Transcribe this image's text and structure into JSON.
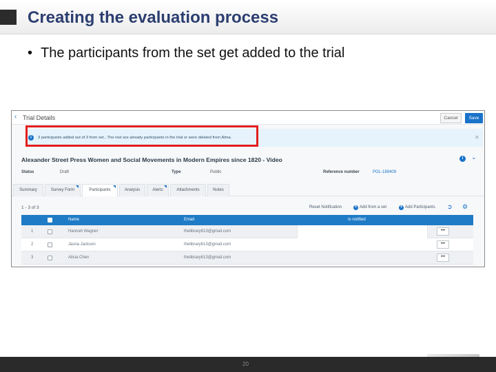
{
  "slide": {
    "title": "Creating the evaluation process",
    "bullet": "The participants from the set get added to the trial",
    "page_number": "20"
  },
  "app": {
    "page_heading": "Trial Details",
    "cancel_label": "Cancel",
    "save_label": "Save",
    "banner_text": "3 participants added out of 3 from set.. The rest are already participants in the trial or were deleted from Alma.",
    "record_title": "Alexander Street Press Women and Social Movements in Modern Empires since 1820 - Video",
    "fields": {
      "status_label": "Status",
      "status_value": "Draft",
      "type_label": "Type",
      "type_value": "Public",
      "ref_label": "Reference number",
      "ref_value": "POL-189409"
    },
    "tabs": [
      {
        "label": "Summary",
        "active": false
      },
      {
        "label": "Survey Form",
        "active": false
      },
      {
        "label": "Participants",
        "active": true
      },
      {
        "label": "Analysis",
        "active": false
      },
      {
        "label": "Alerts",
        "active": false
      },
      {
        "label": "Attachments",
        "active": false
      },
      {
        "label": "Notes",
        "active": false
      }
    ],
    "count_text": "1 - 3 of 3",
    "actions": {
      "reset": "Reset Notification",
      "add_set": "Add from a set",
      "add_participants": "Add Participants"
    },
    "table": {
      "headers": {
        "name": "Name",
        "email": "Email",
        "notified": "Is notified"
      },
      "rows": [
        {
          "num": "1",
          "name": "Hannah Wagner",
          "email": "thelibrary613@gmail.com"
        },
        {
          "num": "2",
          "name": "Jasna Jackson",
          "email": "thelibrary613@gmail.com"
        },
        {
          "num": "3",
          "name": "Alicia Chen",
          "email": "thelibrary613@gmail.com"
        }
      ],
      "row_action": "•••"
    }
  },
  "icons": {
    "back": "chevron-left-icon",
    "info": "info-icon",
    "close": "close-icon",
    "add": "plus-circle-icon",
    "export": "export-icon",
    "settings": "gear-icon"
  },
  "colors": {
    "accent": "#1a73c9",
    "table_header": "#1f7bc6",
    "highlight": "#e21e1e",
    "title_text": "#2c3e70"
  }
}
